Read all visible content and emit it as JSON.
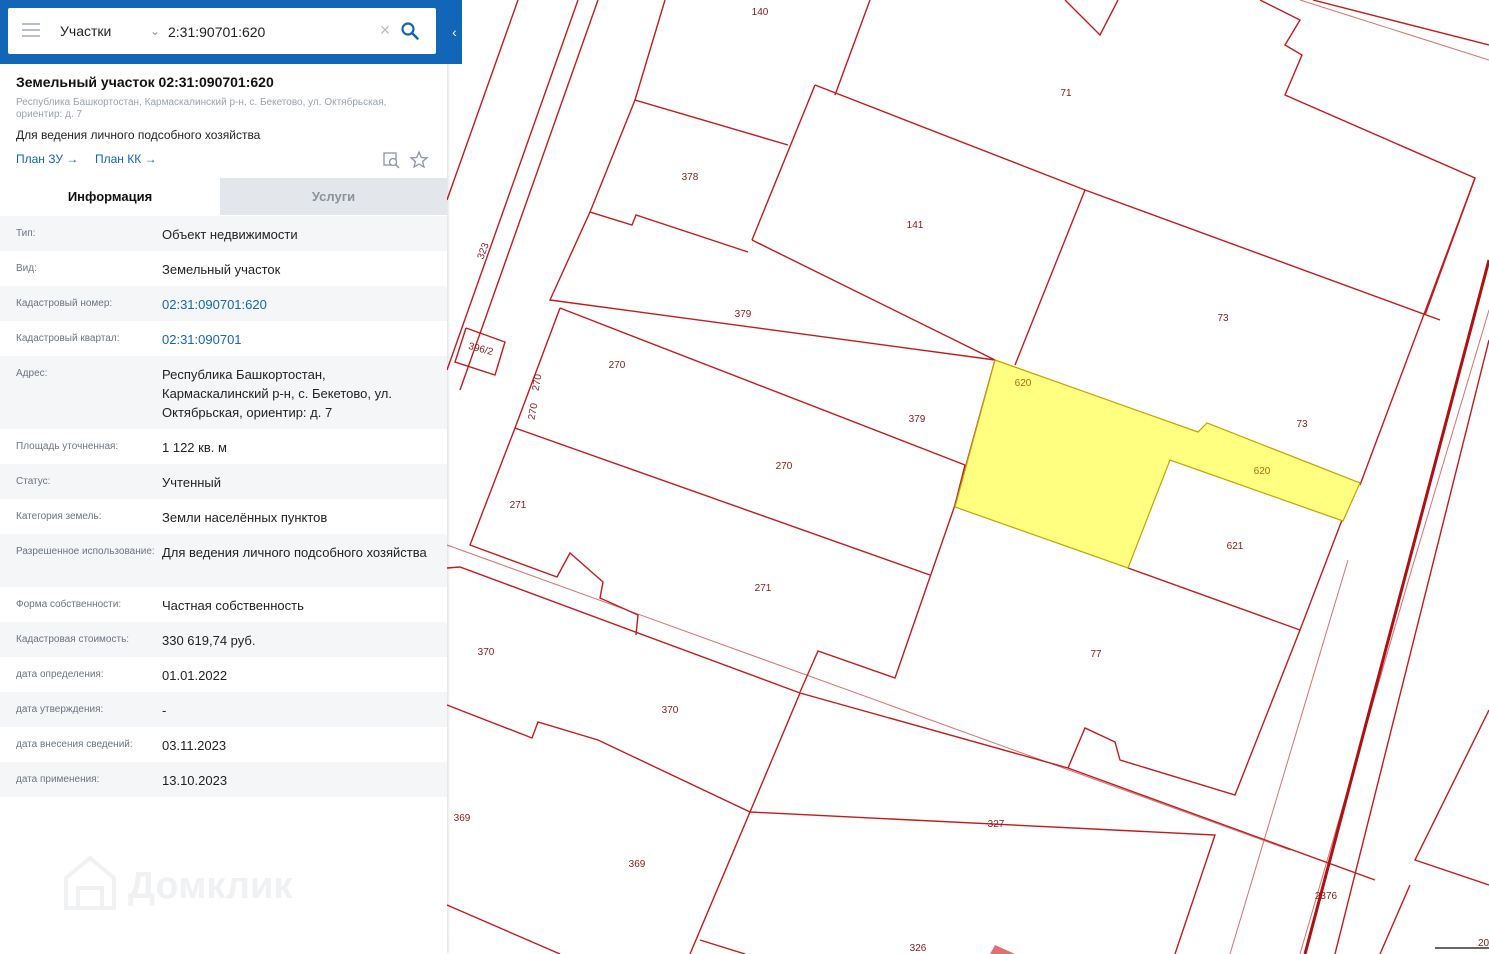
{
  "search": {
    "layer": "Участки",
    "query": "2:31:90701:620"
  },
  "parcel": {
    "title": "Земельный участок 02:31:090701:620",
    "address": "Республика Башкортостан, Кармаскалинский р-н, с. Бекетово, ул. Октябрьская, ориентир: д. 7",
    "purpose": "Для ведения личного подсобного хозяйства",
    "link_plan_zu": "План ЗУ",
    "link_plan_kk": "План КК",
    "arrow": "→"
  },
  "tabs": [
    {
      "label": "Информация",
      "active": true
    },
    {
      "label": "Услуги",
      "active": false
    }
  ],
  "info": [
    {
      "label": "Тип:",
      "value": "Объект недвижимости"
    },
    {
      "label": "Вид:",
      "value": "Земельный участок"
    },
    {
      "label": "Кадастровый номер:",
      "value": "02:31:090701:620",
      "link": true
    },
    {
      "label": "Кадастровый квартал:",
      "value": "02:31:090701",
      "link": true
    },
    {
      "label": "Адрес:",
      "value": "Республика Башкортостан, Кармаскалинский р-н, с. Бекетово, ул. Октябрьская, ориентир: д. 7"
    },
    {
      "label": "Площадь уточненная:",
      "value": "1 122 кв. м"
    },
    {
      "label": "Статус:",
      "value": "Учтенный"
    },
    {
      "label": "Категория земель:",
      "value": "Земли населённых пунктов"
    },
    {
      "label": "Разрешенное использование:",
      "value": "Для ведения личного подсобного хозяйства"
    },
    {
      "label": "Форма собственности:",
      "value": "Частная собственность"
    },
    {
      "label": "Кадастровая стоимость:",
      "value": "330 619,74 руб."
    },
    {
      "label": "дата определения:",
      "value": "01.01.2022"
    },
    {
      "label": "дата утверждения:",
      "value": "-"
    },
    {
      "label": "дата внесения сведений:",
      "value": "03.11.2023"
    },
    {
      "label": "дата применения:",
      "value": "13.10.2023"
    }
  ],
  "watermark": "Домклик",
  "map": {
    "labels": [
      "140",
      "71",
      "378",
      "141",
      "323",
      "379",
      "73",
      "396/2",
      "270",
      "270",
      "270",
      "620",
      "379",
      "73",
      "620",
      "271",
      "270",
      "621",
      "271",
      "370",
      "77",
      "370",
      "369",
      "327",
      "369",
      "2376",
      "326"
    ],
    "selected_color": "#ffff80",
    "boundary_color": "#c41a1a",
    "scale_fragment": "20"
  },
  "colors": {
    "accent": "#1266b8"
  }
}
